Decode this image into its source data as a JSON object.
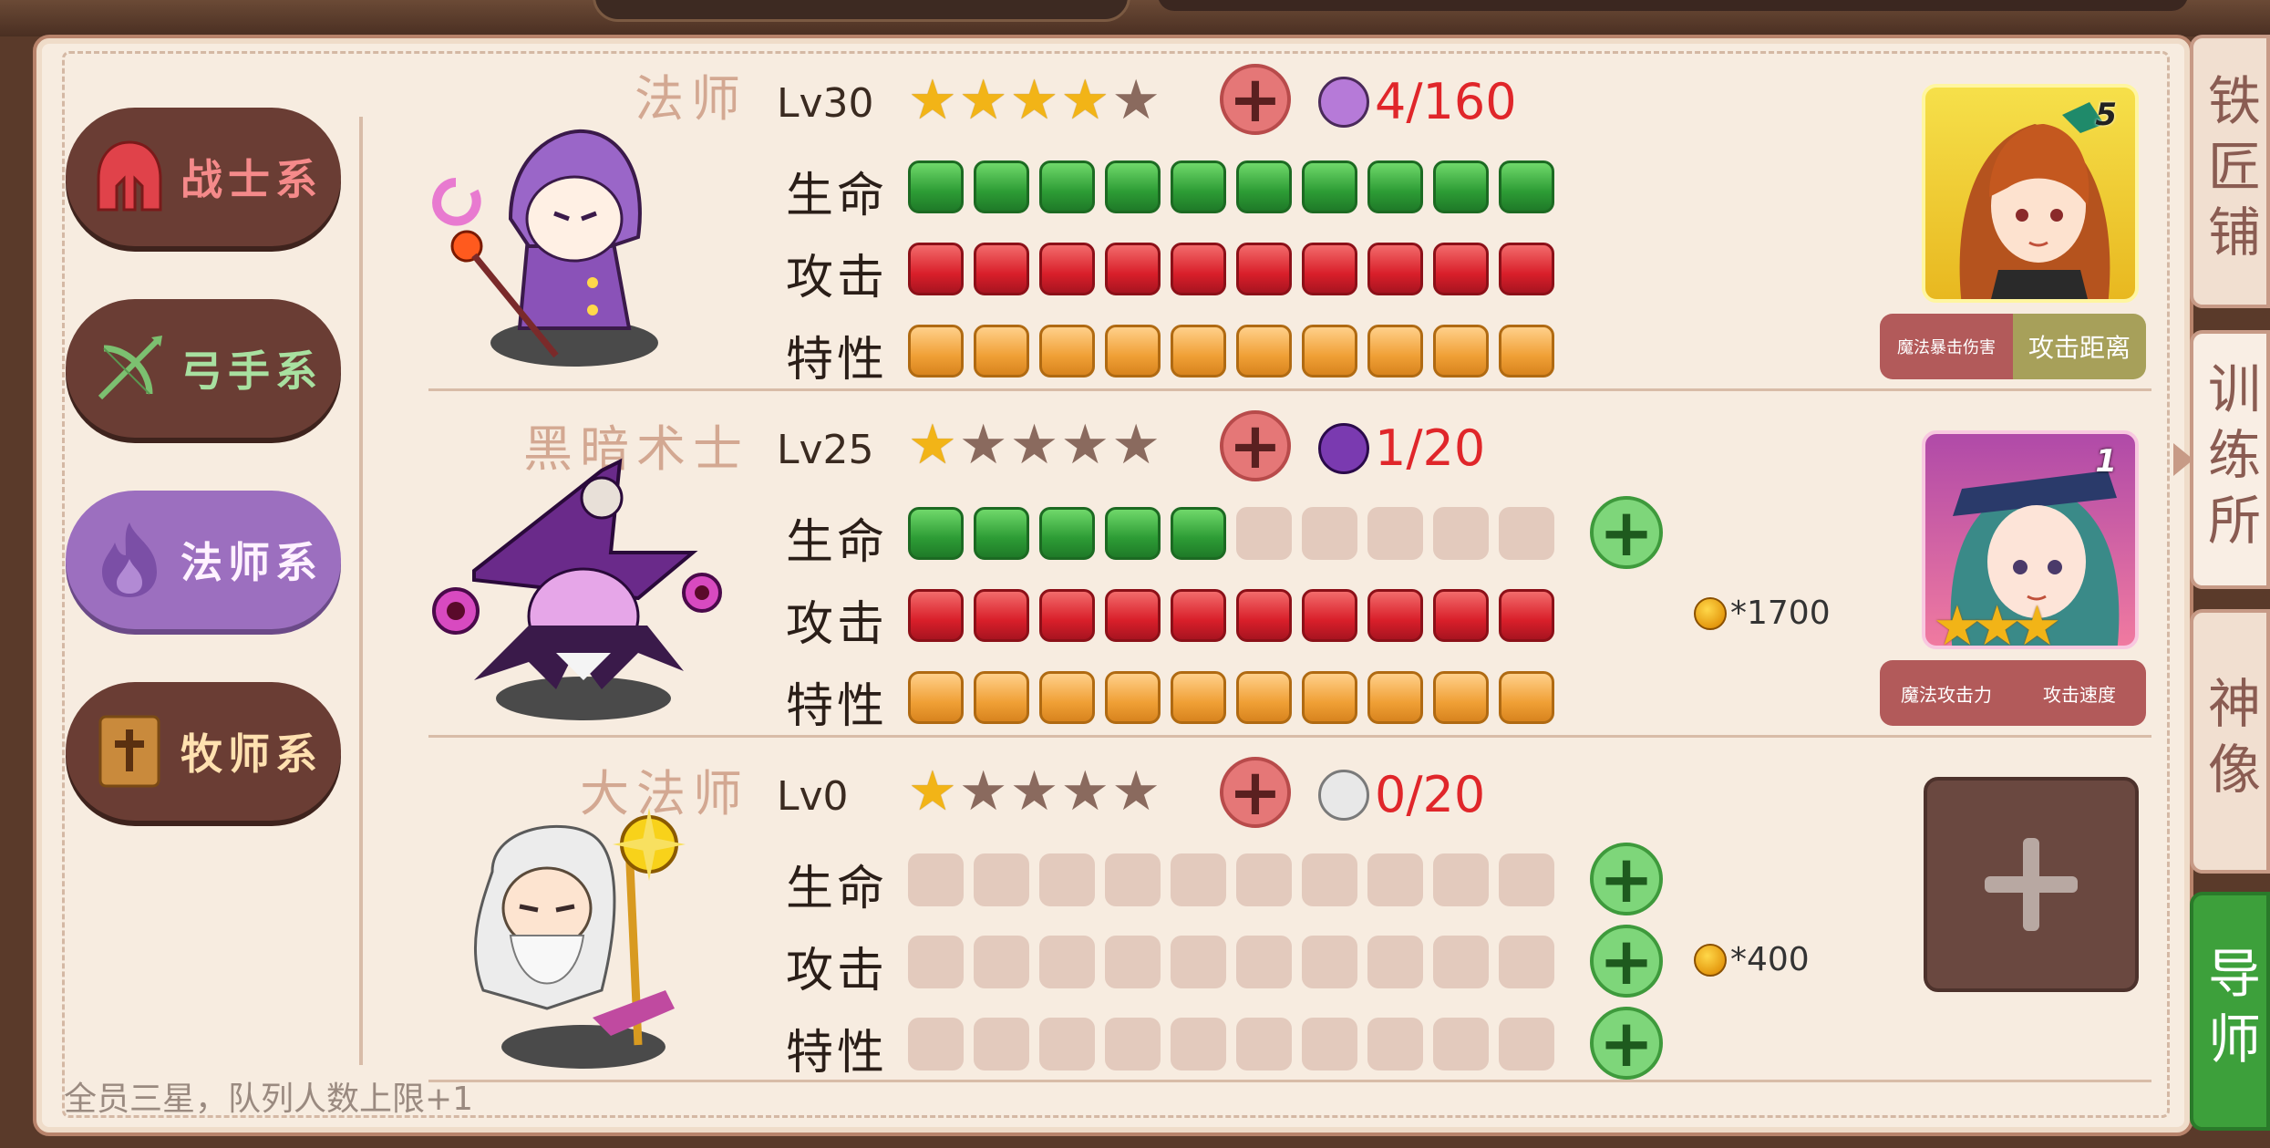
{
  "sidebar": {
    "classes": [
      {
        "label": "战士系",
        "icon": "helmet-icon",
        "color": "#f58a8a"
      },
      {
        "label": "弓手系",
        "icon": "bow-icon",
        "color": "#a8e0a0"
      },
      {
        "label": "法师系",
        "icon": "flame-icon",
        "color": "#9c6fbf",
        "active": true
      },
      {
        "label": "牧师系",
        "icon": "holy-book-icon",
        "color": "#ffe1b0"
      }
    ]
  },
  "footnote": "全员三星，队列人数上限+1",
  "units": [
    {
      "name": "法师",
      "level": "Lv30",
      "stars": 4,
      "shards": "4/160",
      "stats": [
        {
          "label": "生命",
          "filled": 10,
          "color": "green"
        },
        {
          "label": "攻击",
          "filled": 10,
          "color": "red"
        },
        {
          "label": "特性",
          "filled": 10,
          "color": "orange"
        }
      ],
      "mentor": {
        "number": "5",
        "tags": [
          "魔法暴击伤害",
          "攻击距离"
        ]
      }
    },
    {
      "name": "黑暗术士",
      "level": "Lv25",
      "stars": 1,
      "shards": "1/20",
      "stats": [
        {
          "label": "生命",
          "filled": 5,
          "color": "green"
        },
        {
          "label": "攻击",
          "filled": 10,
          "color": "red"
        },
        {
          "label": "特性",
          "filled": 10,
          "color": "orange"
        }
      ],
      "upgrade_cost": "*1700",
      "mentor": {
        "number": "1",
        "tags": [
          "魔法攻击力",
          "攻击速度"
        ]
      }
    },
    {
      "name": "大法师",
      "level": "Lv0",
      "stars": 1,
      "shards": "0/20",
      "stats": [
        {
          "label": "生命",
          "filled": 0,
          "color": "green"
        },
        {
          "label": "攻击",
          "filled": 0,
          "color": "red"
        },
        {
          "label": "特性",
          "filled": 0,
          "color": "orange"
        }
      ],
      "upgrade_cost": "*400"
    }
  ],
  "side_tabs": [
    {
      "label": "铁匠铺"
    },
    {
      "label": "训练所"
    },
    {
      "label": "神像"
    },
    {
      "label": "导师",
      "active": true
    }
  ]
}
